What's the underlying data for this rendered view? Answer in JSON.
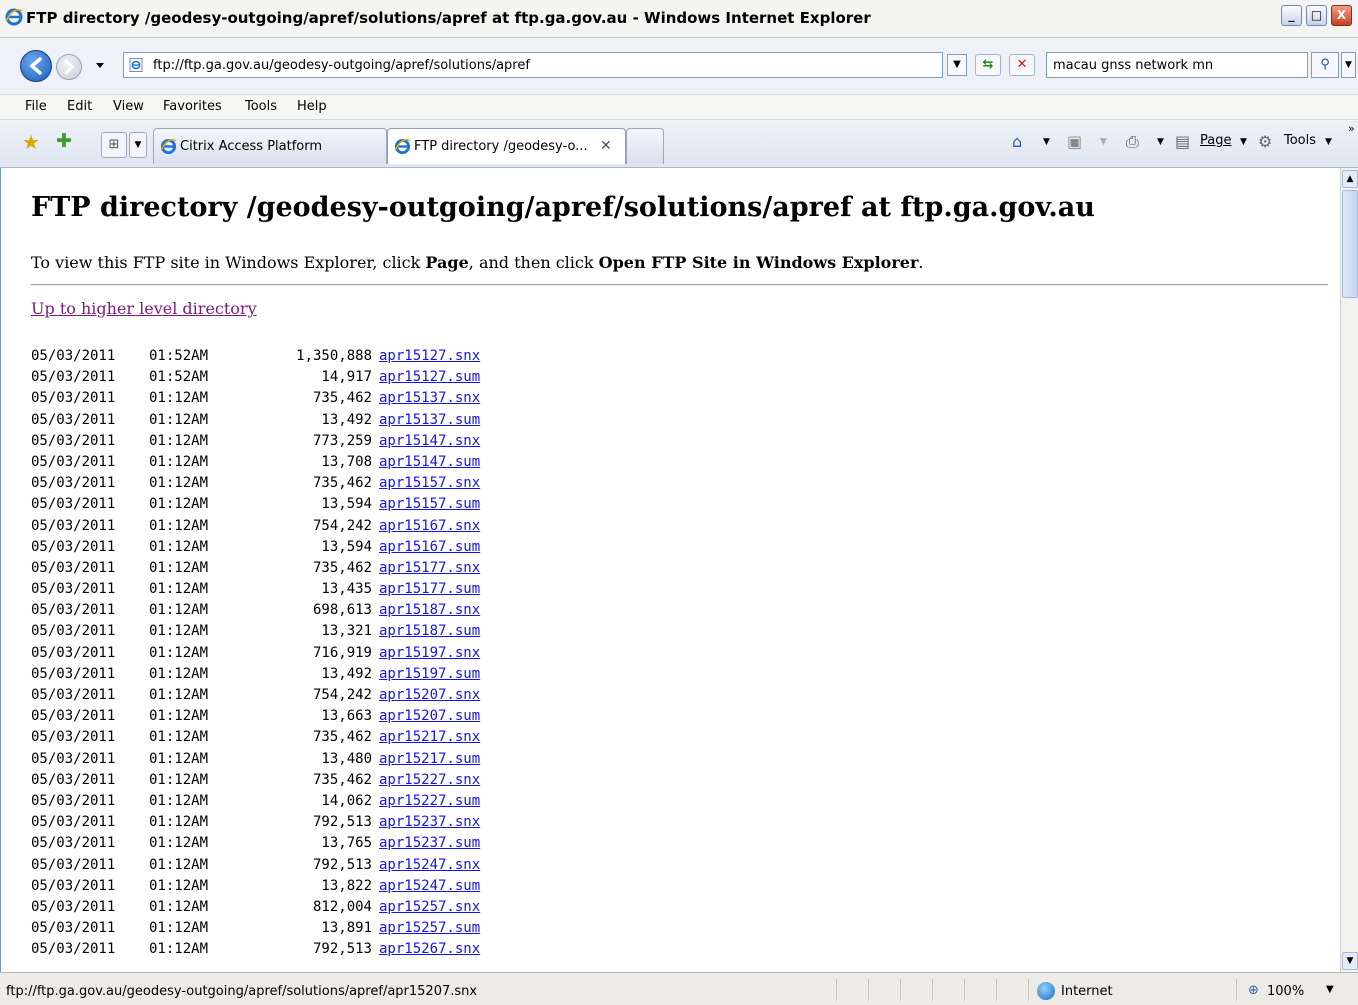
{
  "window": {
    "title": "FTP directory /geodesy-outgoing/apref/solutions/apref at ftp.ga.gov.au - Windows Internet Explorer",
    "min_glyph": "_",
    "max_glyph": "□",
    "close_glyph": "X"
  },
  "addressbar": {
    "url": "ftp://ftp.ga.gov.au/geodesy-outgoing/apref/solutions/apref",
    "search_value": "macau gnss network mn"
  },
  "menu": {
    "items": [
      "File",
      "Edit",
      "View",
      "Favorites",
      "Tools",
      "Help"
    ]
  },
  "tabs": {
    "items": [
      {
        "label": "Citrix Access Platform",
        "active": false
      },
      {
        "label": "FTP directory /geodesy-o...",
        "active": true
      }
    ]
  },
  "commandbar": {
    "page_label": "Page",
    "tools_label": "Tools"
  },
  "page": {
    "heading": "FTP directory /geodesy-outgoing/apref/solutions/apref at ftp.ga.gov.au",
    "instructions_prefix": "To view this FTP site in Windows Explorer, click ",
    "instructions_page": "Page",
    "instructions_middle": ", and then click ",
    "instructions_open": "Open FTP Site in Windows Explorer",
    "instructions_suffix": ".",
    "up_link": "Up to higher level directory",
    "files": [
      {
        "date": "05/03/2011",
        "time": "01:52AM",
        "size": "1,350,888",
        "name": "apr15127.snx"
      },
      {
        "date": "05/03/2011",
        "time": "01:52AM",
        "size": "14,917",
        "name": "apr15127.sum"
      },
      {
        "date": "05/03/2011",
        "time": "01:12AM",
        "size": "735,462",
        "name": "apr15137.snx"
      },
      {
        "date": "05/03/2011",
        "time": "01:12AM",
        "size": "13,492",
        "name": "apr15137.sum"
      },
      {
        "date": "05/03/2011",
        "time": "01:12AM",
        "size": "773,259",
        "name": "apr15147.snx"
      },
      {
        "date": "05/03/2011",
        "time": "01:12AM",
        "size": "13,708",
        "name": "apr15147.sum"
      },
      {
        "date": "05/03/2011",
        "time": "01:12AM",
        "size": "735,462",
        "name": "apr15157.snx"
      },
      {
        "date": "05/03/2011",
        "time": "01:12AM",
        "size": "13,594",
        "name": "apr15157.sum"
      },
      {
        "date": "05/03/2011",
        "time": "01:12AM",
        "size": "754,242",
        "name": "apr15167.snx"
      },
      {
        "date": "05/03/2011",
        "time": "01:12AM",
        "size": "13,594",
        "name": "apr15167.sum"
      },
      {
        "date": "05/03/2011",
        "time": "01:12AM",
        "size": "735,462",
        "name": "apr15177.snx"
      },
      {
        "date": "05/03/2011",
        "time": "01:12AM",
        "size": "13,435",
        "name": "apr15177.sum"
      },
      {
        "date": "05/03/2011",
        "time": "01:12AM",
        "size": "698,613",
        "name": "apr15187.snx"
      },
      {
        "date": "05/03/2011",
        "time": "01:12AM",
        "size": "13,321",
        "name": "apr15187.sum"
      },
      {
        "date": "05/03/2011",
        "time": "01:12AM",
        "size": "716,919",
        "name": "apr15197.snx"
      },
      {
        "date": "05/03/2011",
        "time": "01:12AM",
        "size": "13,492",
        "name": "apr15197.sum"
      },
      {
        "date": "05/03/2011",
        "time": "01:12AM",
        "size": "754,242",
        "name": "apr15207.snx"
      },
      {
        "date": "05/03/2011",
        "time": "01:12AM",
        "size": "13,663",
        "name": "apr15207.sum"
      },
      {
        "date": "05/03/2011",
        "time": "01:12AM",
        "size": "735,462",
        "name": "apr15217.snx"
      },
      {
        "date": "05/03/2011",
        "time": "01:12AM",
        "size": "13,480",
        "name": "apr15217.sum"
      },
      {
        "date": "05/03/2011",
        "time": "01:12AM",
        "size": "735,462",
        "name": "apr15227.snx"
      },
      {
        "date": "05/03/2011",
        "time": "01:12AM",
        "size": "14,062",
        "name": "apr15227.sum"
      },
      {
        "date": "05/03/2011",
        "time": "01:12AM",
        "size": "792,513",
        "name": "apr15237.snx"
      },
      {
        "date": "05/03/2011",
        "time": "01:12AM",
        "size": "13,765",
        "name": "apr15237.sum"
      },
      {
        "date": "05/03/2011",
        "time": "01:12AM",
        "size": "792,513",
        "name": "apr15247.snx"
      },
      {
        "date": "05/03/2011",
        "time": "01:12AM",
        "size": "13,822",
        "name": "apr15247.sum"
      },
      {
        "date": "05/03/2011",
        "time": "01:12AM",
        "size": "812,004",
        "name": "apr15257.snx"
      },
      {
        "date": "05/03/2011",
        "time": "01:12AM",
        "size": "13,891",
        "name": "apr15257.sum"
      },
      {
        "date": "05/03/2011",
        "time": "01:12AM",
        "size": "792,513",
        "name": "apr15267.snx"
      }
    ]
  },
  "statusbar": {
    "text": "ftp://ftp.ga.gov.au/geodesy-outgoing/apref/solutions/apref/apr15207.snx",
    "zone": "Internet",
    "zoom": "100%"
  }
}
